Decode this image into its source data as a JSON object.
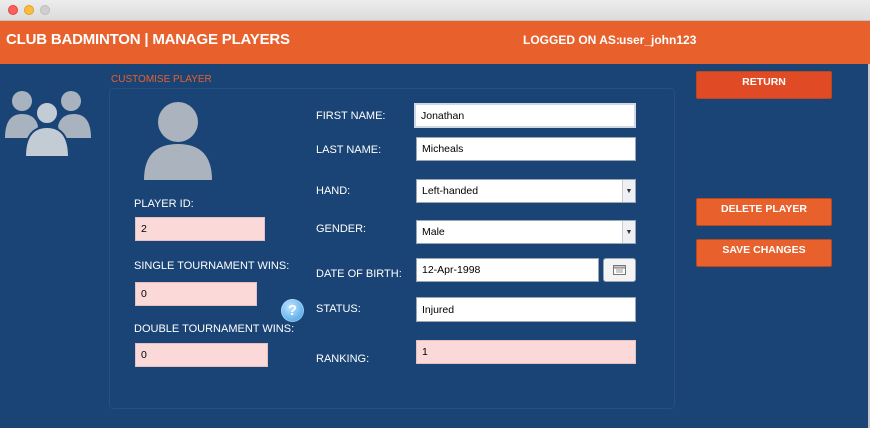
{
  "window": {
    "traffic_lights": [
      "close",
      "minimize",
      "zoom"
    ]
  },
  "header": {
    "title": "CLUB BADMINTON | MANAGE PLAYERS",
    "logged_label": "LOGGED ON AS:",
    "username": "user_john123"
  },
  "panel": {
    "caption": "CUSTOMISE PLAYER"
  },
  "left": {
    "player_id_label": "PLAYER ID:",
    "player_id_value": "2",
    "single_wins_label": "SINGLE TOURNAMENT WINS:",
    "single_wins_value": "0",
    "double_wins_label": "DOUBLE TOURNAMENT WINS:",
    "double_wins_value": "0"
  },
  "form": {
    "first_name_label": "FIRST NAME:",
    "first_name_value": "Jonathan",
    "last_name_label": "LAST NAME:",
    "last_name_value": "Micheals",
    "hand_label": "HAND:",
    "hand_value": "Left-handed",
    "gender_label": "GENDER:",
    "gender_value": "Male",
    "dob_label": "DATE OF BIRTH:",
    "dob_value": "12-Apr-1998",
    "status_label": "STATUS:",
    "status_value": "Injured",
    "ranking_label": "RANKING:",
    "ranking_value": "1"
  },
  "actions": {
    "return": "RETURN",
    "delete": "DELETE PLAYER",
    "save": "SAVE CHANGES"
  },
  "icons": {
    "group": "users-group-icon",
    "avatar": "person-avatar-icon",
    "help": "help-icon",
    "calendar": "calendar-icon",
    "dropdown": "chevron-down-icon"
  },
  "colors": {
    "accent": "#e8602c",
    "background": "#1a4475",
    "readonly_field": "#fbd9d9"
  }
}
